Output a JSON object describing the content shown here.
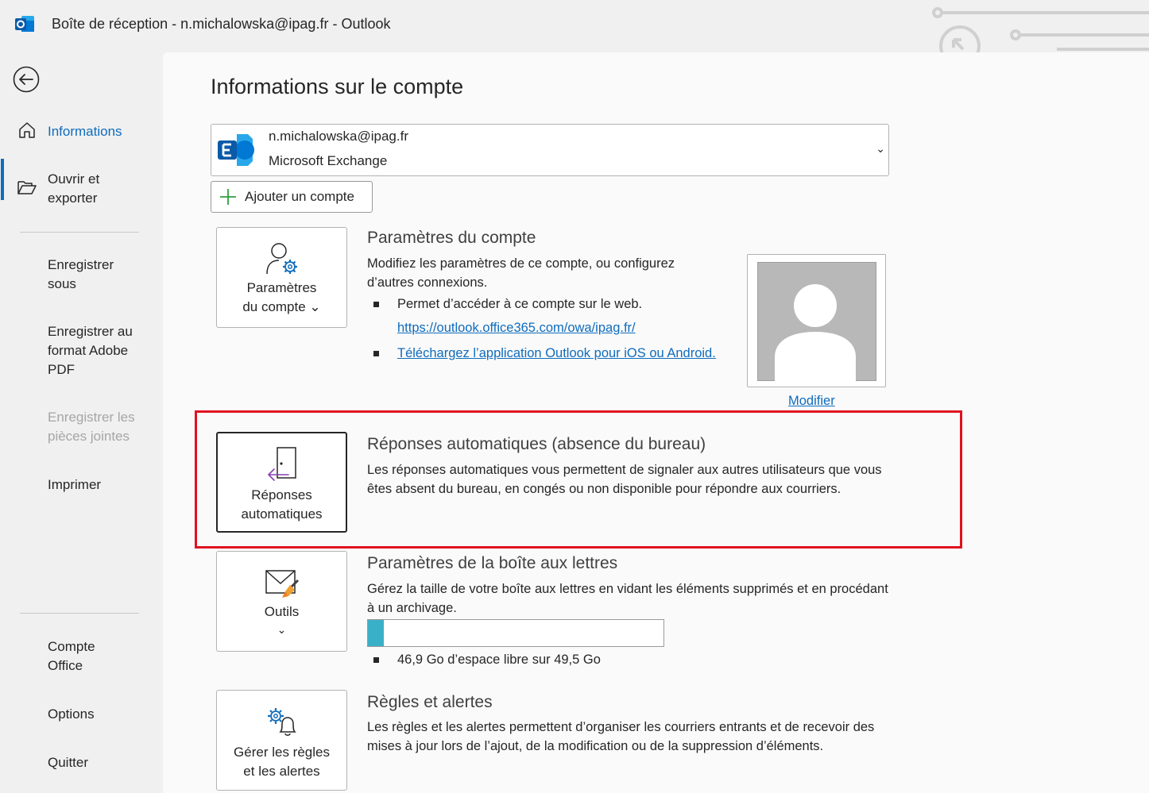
{
  "window": {
    "title": "Boîte de réception - n.michalowska@ipag.fr  -  Outlook"
  },
  "nav": {
    "back_icon": "back-arrow-icon",
    "items": [
      {
        "label": "Informations",
        "icon": "home-icon",
        "state": "active"
      },
      {
        "label": "Ouvrir et exporter",
        "icon": "folder-open-icon",
        "state": "normal"
      },
      {
        "label": "Enregistrer sous",
        "state": "normal"
      },
      {
        "label": "Enregistrer au format Adobe PDF",
        "state": "normal"
      },
      {
        "label": "Enregistrer les pièces jointes",
        "state": "disabled"
      },
      {
        "label": "Imprimer",
        "state": "normal"
      },
      {
        "label": "Compte Office",
        "state": "normal"
      },
      {
        "label": "Options",
        "state": "normal"
      },
      {
        "label": "Quitter",
        "state": "normal"
      }
    ]
  },
  "main": {
    "title": "Informations sur le compte",
    "account": {
      "email": "n.michalowska@ipag.fr",
      "type": "Microsoft Exchange",
      "chevron": "⌄"
    },
    "add_account_label": "Ajouter un compte",
    "account_settings": {
      "tile_label_line1": "Paramètres",
      "tile_label_line2": "du compte ⌄",
      "title": "Paramètres du compte",
      "desc": "Modifiez les paramètres de ce compte, ou configurez d’autres connexions.",
      "bullet1": "Permet d’accéder à ce compte sur le web.",
      "link1": "https://outlook.office365.com/owa/ipag.fr/",
      "link2": "Téléchargez l’application Outlook pour iOS ou Android.",
      "photo_link": "Modifier"
    },
    "auto_replies": {
      "tile_label_line1": "Réponses",
      "tile_label_line2": "automatiques",
      "title": "Réponses automatiques (absence du bureau)",
      "desc": "Les réponses automatiques vous permettent de signaler aux autres utilisateurs que vous êtes absent du bureau, en congés ou non disponible pour répondre aux courriers."
    },
    "mailbox": {
      "tile_label": "Outils",
      "tile_chevron": "⌄",
      "title": "Paramètres de la boîte aux lettres",
      "desc": "Gérez la taille de votre boîte aux lettres en vidant les éléments supprimés et en procédant à un archivage.",
      "used_fraction": 0.053,
      "storage_text": "46,9 Go d’espace libre sur 49,5 Go"
    },
    "rules": {
      "tile_label_line1": "Gérer les règles",
      "tile_label_line2": "et les alertes",
      "title": "Règles et alertes",
      "desc": "Les règles et les alertes permettent d’organiser les courriers entrants et de recevoir des mises à jour lors de l’ajout, de la modification ou de la suppression d’éléments."
    }
  }
}
